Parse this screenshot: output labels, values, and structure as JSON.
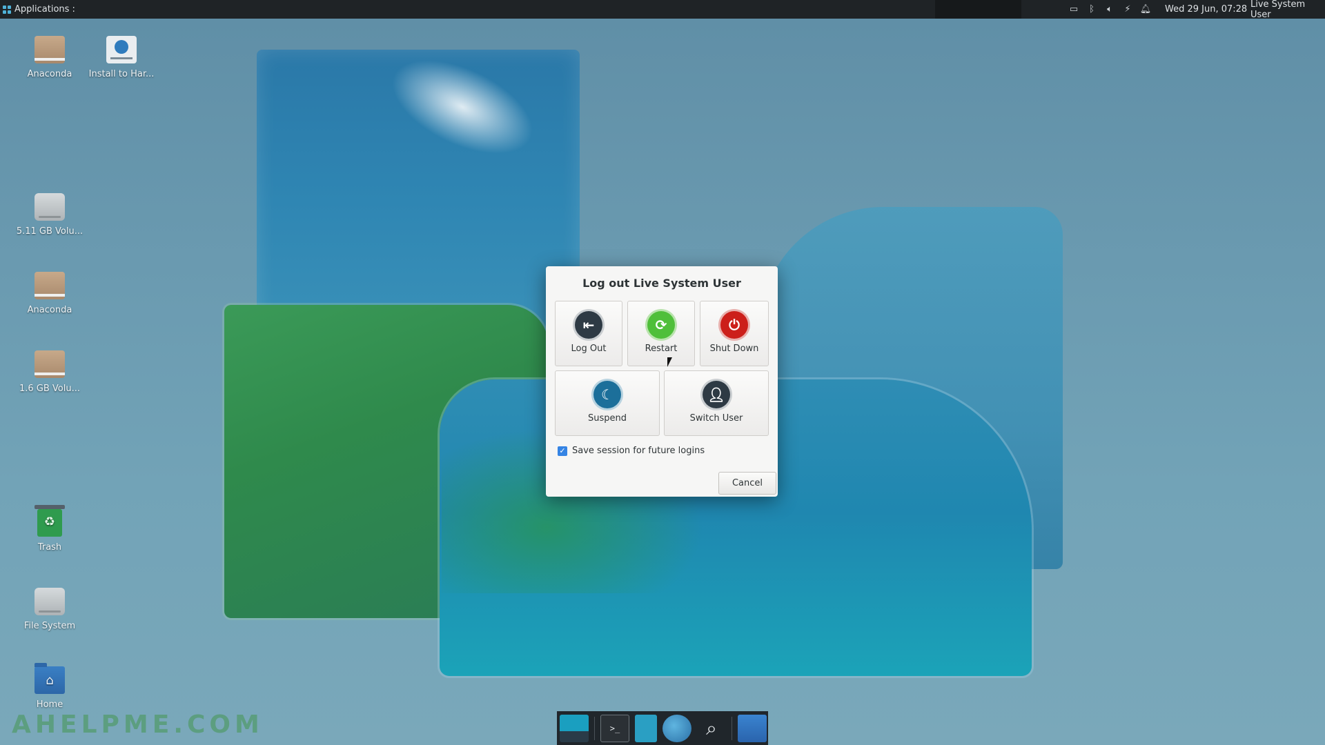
{
  "panel": {
    "apps_label": "Applications :",
    "clock": "Wed 29 Jun, 07:28",
    "user": "Live System User",
    "tray_icons": [
      "display-icon",
      "bluetooth-icon",
      "volume-icon",
      "power-icon",
      "bell-icon"
    ]
  },
  "desktop_icons": [
    {
      "label": "Anaconda",
      "icon": "drive-icon"
    },
    {
      "label": "Install to Har...",
      "icon": "installer-icon"
    },
    {
      "label": "5.11 GB Volu...",
      "icon": "disk-icon"
    },
    {
      "label": "Anaconda",
      "icon": "drive-icon"
    },
    {
      "label": "1.6 GB Volu...",
      "icon": "drive-icon"
    },
    {
      "label": "Trash",
      "icon": "trash-icon"
    },
    {
      "label": "File System",
      "icon": "disk-icon"
    },
    {
      "label": "Home",
      "icon": "home-folder-icon"
    }
  ],
  "dialog": {
    "title": "Log out Live System User",
    "actions": {
      "logout": "Log Out",
      "restart": "Restart",
      "shutdown": "Shut Down",
      "suspend": "Suspend",
      "switch_user": "Switch User"
    },
    "save_session_label": "Save session for future logins",
    "save_session_checked": true,
    "cancel": "Cancel"
  },
  "dock": {
    "items": [
      "show-desktop-icon",
      "terminal-icon",
      "file-manager-icon",
      "web-browser-icon",
      "app-finder-icon",
      "folder-icon"
    ],
    "terminal_glyph": ">_"
  },
  "watermark": "AHELPME.COM",
  "colors": {
    "restart": "#4fbf3a",
    "shutdown": "#cc1f1a",
    "suspend": "#1c6f9a",
    "dark": "#2e3a44",
    "checkbox": "#3584e4",
    "panel": "#1f2326"
  }
}
